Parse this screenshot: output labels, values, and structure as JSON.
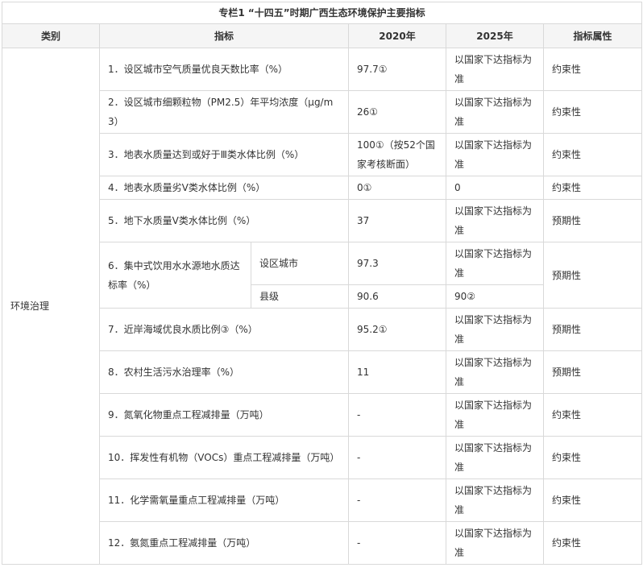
{
  "title": "专栏1 “十四五”时期广西生态环境保护主要指标",
  "headers": {
    "category": "类别",
    "indicator": "指标",
    "y2020": "2020年",
    "y2025": "2025年",
    "attribute": "指标属性"
  },
  "category": "环境治理",
  "rows": [
    {
      "indicator": "1．设区城市空气质量优良天数比率（%）",
      "v2020": "97.7①",
      "v2025": "以国家下达指标为准",
      "attr": "约束性"
    },
    {
      "indicator": "2．设区城市细颗粒物（PM2.5）年平均浓度（μg/m3）",
      "v2020": "26①",
      "v2025": "以国家下达指标为准",
      "attr": "约束性"
    },
    {
      "indicator": "3．地表水质量达到或好于Ⅲ类水体比例（%）",
      "v2020": "100①（按52个国家考核断面）",
      "v2025": "以国家下达指标为准",
      "attr": "约束性"
    },
    {
      "indicator": "4．地表水质量劣Ⅴ类水体比例（%）",
      "v2020": "0①",
      "v2025": "0",
      "attr": "约束性"
    },
    {
      "indicator": "5．地下水质量Ⅴ类水体比例（%）",
      "v2020": "37",
      "v2025": "以国家下达指标为准",
      "attr": "预期性"
    },
    {
      "indicator": "6．集中式饮用水水源地水质达标率（%）",
      "sub": [
        {
          "label": "设区城市",
          "v2020": "97.3",
          "v2025": "以国家下达指标为准"
        },
        {
          "label": "县级",
          "v2020": "90.6",
          "v2025": "90②"
        }
      ],
      "attr": "预期性"
    },
    {
      "indicator": "7．近岸海域优良水质比例③（%）",
      "v2020": "95.2①",
      "v2025": "以国家下达指标为准",
      "attr": "预期性"
    },
    {
      "indicator": "8．农村生活污水治理率（%）",
      "v2020": "11",
      "v2025": "以国家下达指标为准",
      "attr": "预期性"
    },
    {
      "indicator": "9．氮氧化物重点工程减排量（万吨）",
      "v2020": "-",
      "v2025": "以国家下达指标为准",
      "attr": "约束性"
    },
    {
      "indicator": "10．挥发性有机物（VOCs）重点工程减排量（万吨）",
      "v2020": "-",
      "v2025": "以国家下达指标为准",
      "attr": "约束性"
    },
    {
      "indicator": "11．化学需氧量重点工程减排量（万吨）",
      "v2020": "-",
      "v2025": "以国家下达指标为准",
      "attr": "约束性"
    },
    {
      "indicator": "12．氨氮重点工程减排量（万吨）",
      "v2020": "-",
      "v2025": "以国家下达指标为准",
      "attr": "约束性"
    }
  ]
}
